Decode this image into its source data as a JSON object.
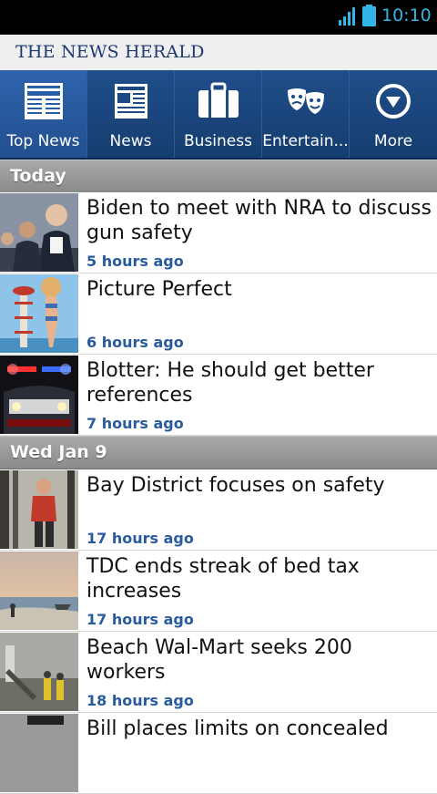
{
  "status_bar": {
    "time": "10:10",
    "accent": "#33b5e5"
  },
  "masthead": {
    "title": "THE NEWS HERALD"
  },
  "nav": {
    "tabs": [
      {
        "label": "Top News",
        "icon": "newspaper-front-icon",
        "active": true
      },
      {
        "label": "News",
        "icon": "newspaper-icon",
        "active": false
      },
      {
        "label": "Business",
        "icon": "briefcase-icon",
        "active": false
      },
      {
        "label": "Entertain...",
        "icon": "theater-masks-icon",
        "active": false
      },
      {
        "label": "More",
        "icon": "chevron-circle-down-icon",
        "active": false
      }
    ]
  },
  "sections": [
    {
      "title": "Today",
      "articles": [
        {
          "headline": "Biden to meet with NRA to discuss gun safety",
          "time": "5 hours ago"
        },
        {
          "headline": "Picture Perfect",
          "time": "6 hours ago"
        },
        {
          "headline": "Blotter: He should get better references",
          "time": "7 hours ago"
        }
      ]
    },
    {
      "title": "Wed Jan 9",
      "articles": [
        {
          "headline": "Bay District focuses on safety",
          "time": "17 hours ago"
        },
        {
          "headline": "TDC ends streak of bed tax increases",
          "time": "17 hours ago"
        },
        {
          "headline": "Beach Wal-Mart seeks 200 workers",
          "time": "18 hours ago"
        },
        {
          "headline": "Bill places limits on concealed",
          "time": ""
        }
      ]
    }
  ]
}
